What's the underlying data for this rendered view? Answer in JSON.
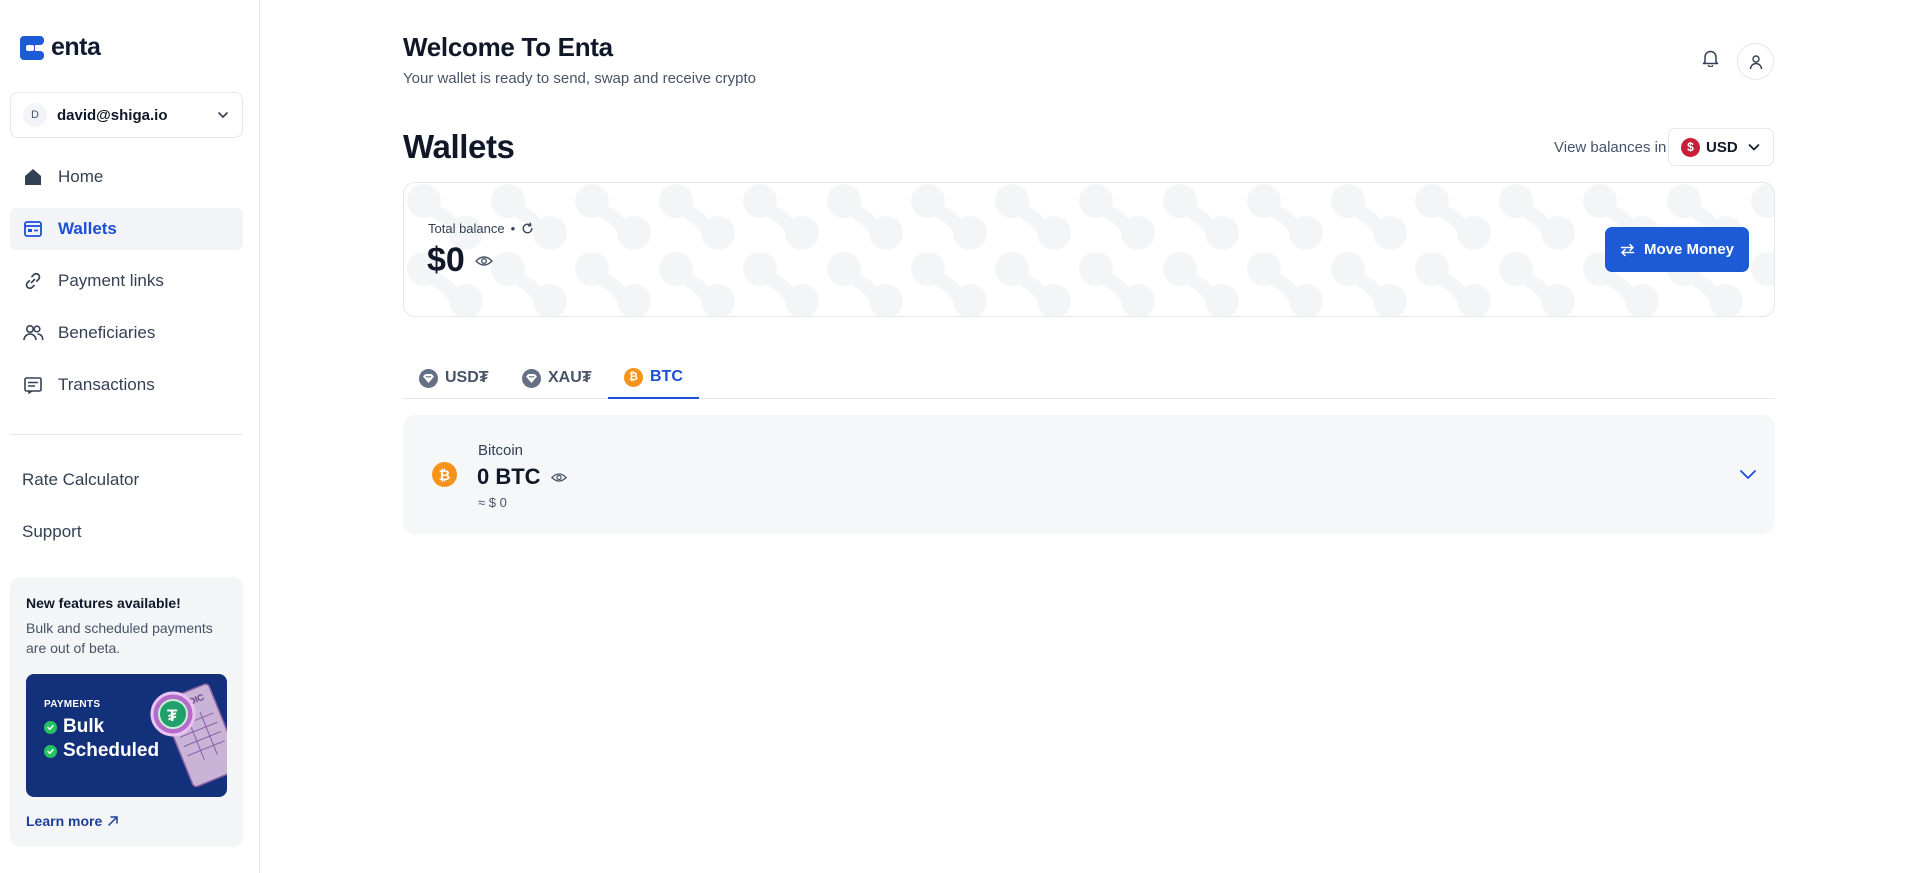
{
  "brand": {
    "name": "enta",
    "color": "#1c5ad6"
  },
  "account": {
    "initial": "D",
    "email": "david@shiga.io"
  },
  "sidebar": {
    "items": [
      {
        "label": "Home",
        "icon": "home-icon"
      },
      {
        "label": "Wallets",
        "icon": "wallet-icon",
        "active": true
      },
      {
        "label": "Payment links",
        "icon": "link-icon"
      },
      {
        "label": "Beneficiaries",
        "icon": "users-icon"
      },
      {
        "label": "Transactions",
        "icon": "receipt-icon"
      }
    ],
    "secondary": [
      {
        "label": "Rate Calculator"
      },
      {
        "label": "Support"
      }
    ],
    "promo": {
      "title": "New features available!",
      "text": "Bulk and scheduled payments are out of beta.",
      "kicker": "PAYMENTS",
      "line1": "Bulk",
      "line2": "Scheduled",
      "art_label": "INVOICE",
      "link": "Learn more"
    }
  },
  "header": {
    "title": "Welcome To Enta",
    "subtitle": "Your wallet is ready to send, swap and receive crypto"
  },
  "wallets": {
    "title": "Wallets",
    "view_label": "View balances in",
    "currency": {
      "code": "USD",
      "symbol": "$",
      "color": "#c81e3a"
    },
    "balance": {
      "label": "Total balance",
      "separator": "•",
      "amount": "$0"
    },
    "move_money_label": "Move Money",
    "tabs": [
      {
        "label": "USD₮",
        "icon": "tether-icon",
        "active": false
      },
      {
        "label": "XAU₮",
        "icon": "tether-gold-icon",
        "active": false
      },
      {
        "label": "BTC",
        "icon": "bitcoin-icon",
        "active": true
      }
    ],
    "asset": {
      "name": "Bitcoin",
      "amount": "0 BTC",
      "fiat": "≈ $ 0",
      "color": "#f7931a"
    }
  }
}
